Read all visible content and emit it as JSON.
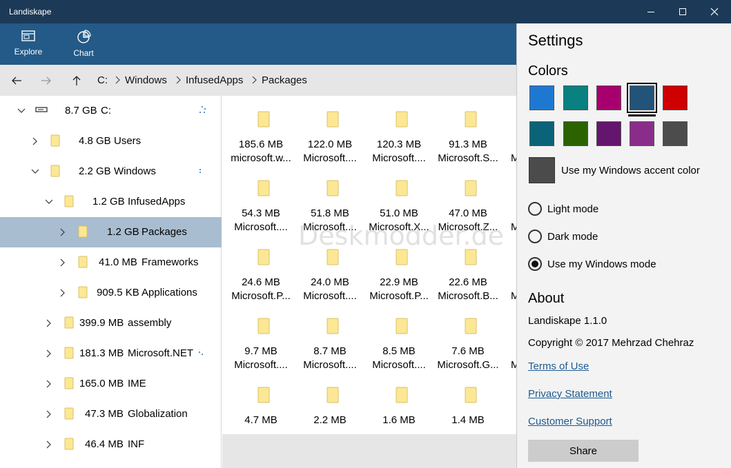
{
  "window": {
    "title": "Landiskape",
    "minimize": "minimize",
    "maximize": "maximize",
    "close": "close"
  },
  "toolbar": {
    "explore_label": "Explore",
    "chart_label": "Chart"
  },
  "breadcrumb": [
    "C:",
    "Windows",
    "InfusedApps",
    "Packages"
  ],
  "tree": [
    {
      "size": "8.7 GB",
      "name": "C:",
      "expanded": true
    },
    {
      "size": "4.8 GB",
      "name": "Users",
      "expanded": false
    },
    {
      "size": "2.2 GB",
      "name": "Windows",
      "expanded": true
    },
    {
      "size": "1.2 GB",
      "name": "InfusedApps",
      "expanded": true
    },
    {
      "size": "1.2 GB",
      "name": "Packages",
      "expanded": false,
      "selected": true
    },
    {
      "size": "41.0 MB",
      "name": "Frameworks",
      "expanded": false
    },
    {
      "size": "909.5 KB",
      "name": "Applications",
      "expanded": false
    },
    {
      "size": "399.9 MB",
      "name": "assembly",
      "expanded": false
    },
    {
      "size": "181.3 MB",
      "name": "Microsoft.NET",
      "expanded": false
    },
    {
      "size": "165.0 MB",
      "name": "IME",
      "expanded": false
    },
    {
      "size": "47.3 MB",
      "name": "Globalization",
      "expanded": false
    },
    {
      "size": "46.4 MB",
      "name": "INF",
      "expanded": false
    }
  ],
  "grid": [
    {
      "size": "185.6 MB",
      "name": "microsoft.w..."
    },
    {
      "size": "122.0 MB",
      "name": "Microsoft...."
    },
    {
      "size": "120.3 MB",
      "name": "Microsoft...."
    },
    {
      "size": "91.3 MB",
      "name": "Microsoft.S..."
    },
    {
      "size": "54.3 MB",
      "name": "Microsoft...."
    },
    {
      "size": "51.8 MB",
      "name": "Microsoft...."
    },
    {
      "size": "51.0 MB",
      "name": "Microsoft.X..."
    },
    {
      "size": "47.0 MB",
      "name": "Microsoft.Z..."
    },
    {
      "size": "24.6 MB",
      "name": "Microsoft.P..."
    },
    {
      "size": "24.0 MB",
      "name": "Microsoft...."
    },
    {
      "size": "22.9 MB",
      "name": "Microsoft.P..."
    },
    {
      "size": "22.6 MB",
      "name": "Microsoft.B..."
    },
    {
      "size": "9.7 MB",
      "name": "Microsoft...."
    },
    {
      "size": "8.7 MB",
      "name": "Microsoft...."
    },
    {
      "size": "8.5 MB",
      "name": "Microsoft...."
    },
    {
      "size": "7.6 MB",
      "name": "Microsoft.G..."
    },
    {
      "size": "4.7 MB",
      "name": ""
    },
    {
      "size": "2.2 MB",
      "name": ""
    },
    {
      "size": "1.6 MB",
      "name": ""
    },
    {
      "size": "1.4 MB",
      "name": ""
    }
  ],
  "grid_peek": [
    "M",
    "M",
    "M",
    "M"
  ],
  "watermark": "Deskmodder.de",
  "settings": {
    "title": "Settings",
    "colors_heading": "Colors",
    "swatches": [
      "#1e78d2",
      "#0a8080",
      "#a7006e",
      "#225378",
      "#cf0000",
      "#0a6378",
      "#2a6300",
      "#64156d",
      "#8a2d8a",
      "#4c4c4c"
    ],
    "selected_swatch": 3,
    "accent_label": "Use my Windows accent color",
    "modes": [
      "Light mode",
      "Dark mode",
      "Use my Windows mode"
    ],
    "selected_mode": 2,
    "about_heading": "About",
    "version": "Landiskape 1.1.0",
    "copyright": "Copyright © 2017 Mehrzad Chehraz",
    "terms": "Terms of Use",
    "privacy": "Privacy Statement",
    "support": "Customer Support",
    "share": "Share"
  },
  "colors": {
    "titlebar": "#1c3a57",
    "commandbar": "#235a87",
    "selection": "#a9bdd0",
    "folder": "#fce795"
  }
}
